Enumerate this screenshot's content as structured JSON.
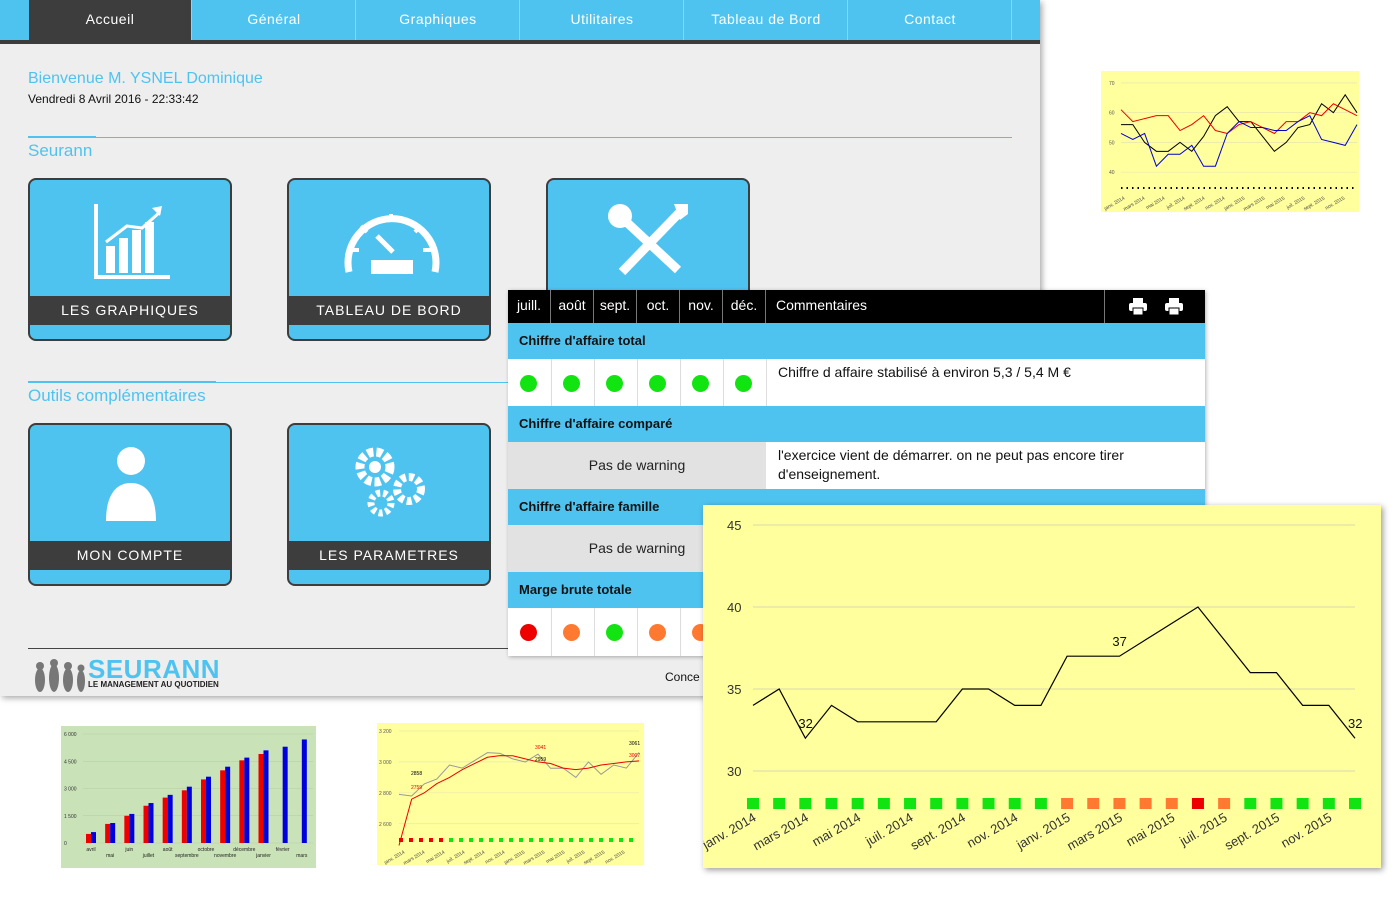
{
  "nav": {
    "tabs": [
      {
        "label": "Accueil"
      },
      {
        "label": "Général"
      },
      {
        "label": "Graphiques"
      },
      {
        "label": "Utilitaires"
      },
      {
        "label": "Tableau de Bord"
      },
      {
        "label": "Contact"
      }
    ]
  },
  "welcome": {
    "text": "Bienvenue M. YSNEL Dominique",
    "date": "Vendredi 8 Avril 2016 - 22:33:42"
  },
  "sections": {
    "main": "Seurann",
    "tools": "Outils complémentaires"
  },
  "tiles": {
    "graphs": "LES GRAPHIQUES",
    "dashboard": "TABLEAU DE BORD",
    "account": "MON COMPTE",
    "params": "LES PARAMETRES"
  },
  "logo": {
    "name": "SEURANN",
    "tagline": "LE MANAGEMENT AU QUOTIDIEN"
  },
  "footer": {
    "text": "Conce"
  },
  "table": {
    "months": [
      "juill.",
      "août",
      "sept.",
      "oct.",
      "nov.",
      "déc."
    ],
    "comments_header": "Commentaires",
    "rows": [
      {
        "title": "Chiffre d'affaire total",
        "dots": [
          "#12e412",
          "#12e412",
          "#12e412",
          "#12e412",
          "#12e412",
          "#12e412"
        ],
        "comment": "Chiffre d affaire stabilisé à environ 5,3 / 5,4 M €"
      },
      {
        "title": "Chiffre d'affaire comparé",
        "warning": "Pas de warning",
        "comment": "l'exercice vient de démarrer. on ne peut pas encore tirer d'enseignement."
      },
      {
        "title": "Chiffre d'affaire famille",
        "warning": "Pas de warning"
      },
      {
        "title": "Marge brute totale",
        "dots": [
          "#ee0000",
          "#ff7a30",
          "#12e412",
          "#ff7a30",
          "#ff7a30"
        ]
      }
    ]
  },
  "colors": {
    "accent": "#4fc3f0",
    "dark": "#3d3d3d",
    "green": "#12e412",
    "orange": "#ff7a30",
    "red": "#ee0000",
    "chartbg": "#ffff9e"
  },
  "chart_data": [
    {
      "type": "line",
      "ylim": [
        28,
        45
      ],
      "yticks": [
        "45",
        "40",
        "35",
        "30"
      ],
      "xlabels": [
        "janv. 2014",
        "mars 2014",
        "mai 2014",
        "juil. 2014",
        "sept. 2014",
        "nov. 2014",
        "janv. 2015",
        "mars 2015",
        "mai 2015",
        "juil. 2015",
        "sept. 2015",
        "nov. 2015"
      ],
      "values": [
        34,
        35,
        32,
        34,
        33,
        33,
        33,
        33,
        35,
        35,
        34,
        34,
        37,
        37,
        37,
        38,
        39,
        40,
        38,
        36,
        36,
        34,
        34,
        32
      ],
      "labels": [
        {
          "i": 2,
          "text": "32"
        },
        {
          "i": 14,
          "text": "37"
        },
        {
          "i": 23,
          "text": "32"
        }
      ],
      "status": [
        "#12e412",
        "#12e412",
        "#12e412",
        "#12e412",
        "#12e412",
        "#12e412",
        "#12e412",
        "#12e412",
        "#12e412",
        "#12e412",
        "#12e412",
        "#12e412",
        "#ff7a30",
        "#ff7a30",
        "#ff7a30",
        "#ff7a30",
        "#ff7a30",
        "#ee0000",
        "#ff7a30",
        "#12e412",
        "#12e412",
        "#12e412",
        "#12e412",
        "#12e412"
      ]
    },
    {
      "type": "line",
      "ylim": [
        35,
        72
      ],
      "yticks": [
        "70",
        "60",
        "50",
        "40"
      ],
      "xlabels": [
        "janv. 2014",
        "mars 2014",
        "mai 2014",
        "juil. 2014",
        "sept. 2014",
        "nov. 2014",
        "janv. 2015",
        "mars 2015",
        "mai 2015",
        "juil. 2015",
        "sept. 2015",
        "nov. 2015"
      ],
      "series": [
        {
          "color": "#000000",
          "values": [
            56,
            56,
            50,
            47,
            47,
            50,
            47,
            52,
            59,
            62,
            57,
            57,
            52,
            47,
            50,
            55,
            56,
            63,
            60,
            66,
            60
          ]
        },
        {
          "color": "#ee0000",
          "values": [
            61,
            57,
            58,
            59,
            59,
            54,
            56,
            59,
            54,
            53,
            56,
            57,
            55,
            53,
            57,
            57,
            60,
            59,
            63,
            61,
            59
          ]
        },
        {
          "color": "#0000cc",
          "values": [
            53,
            51,
            53,
            42,
            46,
            46,
            49,
            42,
            42,
            53,
            57,
            55,
            55,
            54,
            54,
            57,
            59,
            51,
            50,
            49,
            56
          ]
        }
      ]
    },
    {
      "type": "bar",
      "yticks": [
        "6 000",
        "4 500",
        "3 000",
        "1 500",
        "0"
      ],
      "ylim": [
        0,
        6000
      ],
      "categories": [
        "avril",
        "mai",
        "juin",
        "juillet",
        "août",
        "septembre",
        "octobre",
        "novembre",
        "décembre",
        "janvier",
        "février",
        "mars"
      ],
      "series": [
        {
          "color": "#ee0000",
          "values": [
            500,
            1050,
            1500,
            2050,
            2500,
            2900,
            3500,
            4000,
            4550,
            4900
          ]
        },
        {
          "color": "#0000dd",
          "values": [
            600,
            1100,
            1600,
            2200,
            2650,
            3100,
            3650,
            4200,
            4700,
            5100,
            5300,
            5700
          ]
        }
      ]
    },
    {
      "type": "line",
      "ylim": [
        2450,
        3200
      ],
      "yticks": [
        "3 200",
        "3 000",
        "2 800",
        "2 600"
      ],
      "xlabels": [
        "janv. 2014",
        "mars 2014",
        "mai 2014",
        "juil. 2014",
        "sept. 2014",
        "nov. 2014",
        "janv. 2015",
        "mars 2015",
        "mai 2015",
        "juil. 2015",
        "sept. 2015",
        "nov. 2015"
      ],
      "series": [
        {
          "color": "#999999",
          "values": [
            2790,
            2780,
            2858,
            2890,
            2980,
            2960,
            3010,
            3060,
            3055,
            3020,
            3000,
            3050,
            2959,
            2960,
            2900,
            3000,
            2920,
            2980,
            2960,
            3061
          ]
        },
        {
          "color": "#ee0000",
          "values": [
            2460,
            2759,
            2800,
            2860,
            2900,
            2950,
            2990,
            3030,
            3041,
            3040,
            3020,
            3000,
            2990,
            2960,
            2950,
            2960,
            2980,
            2990,
            3000,
            3007
          ]
        }
      ],
      "labels": [
        {
          "text": "2858"
        },
        {
          "text": "2759"
        },
        {
          "text": "3041"
        },
        {
          "text": "2959"
        },
        {
          "text": "3061"
        },
        {
          "text": "3007"
        }
      ]
    }
  ]
}
